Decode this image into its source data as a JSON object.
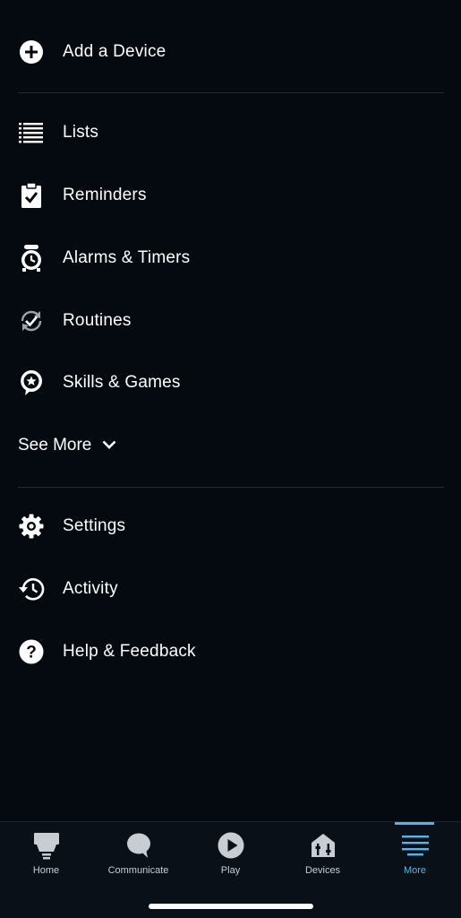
{
  "menu": {
    "add_device": "Add a Device",
    "lists": "Lists",
    "reminders": "Reminders",
    "alarms_timers": "Alarms & Timers",
    "routines": "Routines",
    "skills_games": "Skills & Games",
    "see_more": "See More",
    "settings": "Settings",
    "activity": "Activity",
    "help_feedback": "Help & Feedback"
  },
  "tabs": [
    {
      "label": "Home",
      "icon": "home-icon"
    },
    {
      "label": "Communicate",
      "icon": "communicate-icon"
    },
    {
      "label": "Play",
      "icon": "play-icon"
    },
    {
      "label": "Devices",
      "icon": "devices-icon"
    },
    {
      "label": "More",
      "icon": "more-icon",
      "active": true
    }
  ],
  "colors": {
    "background": "#050a10",
    "accent": "#5ab3e8",
    "text": "#ffffff"
  }
}
